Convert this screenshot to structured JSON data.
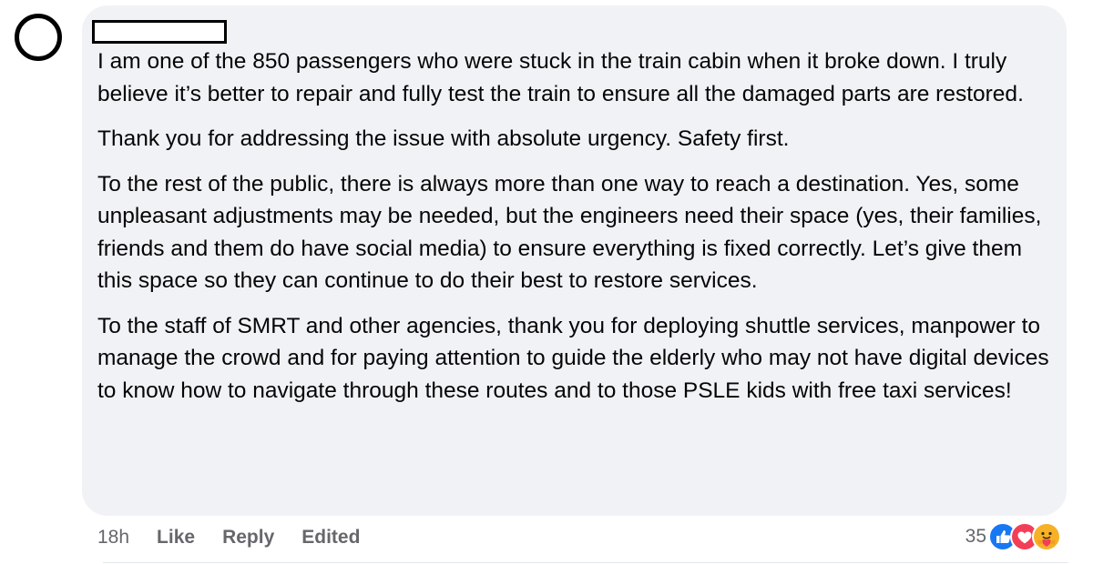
{
  "comment": {
    "paragraphs": [
      "I am one of the 850 passengers who were stuck in the train cabin when it broke down. I truly believe it’s better to repair and fully test the train to ensure all the damaged parts are restored.",
      "Thank you for addressing the issue with absolute urgency. Safety first.",
      "To the rest of the public, there is always more than one way to reach a destination. Yes, some unpleasant adjustments may be needed, but the engineers need their space (yes, their families, friends and them do have social media) to ensure everything is fixed correctly. Let’s give them this space so they can continue to do their best to restore services.",
      "To the staff of SMRT and other agencies, thank you for deploying shuttle services, manpower to manage the crowd and for paying attention to guide the elderly who may not have digital devices to know how to navigate through these routes and to those PSLE kids with free taxi services!"
    ]
  },
  "actions": {
    "time": "18h",
    "like_label": "Like",
    "reply_label": "Reply",
    "edited_label": "Edited"
  },
  "reactions": {
    "count": "35",
    "icons": [
      "like-icon",
      "love-icon",
      "care-icon"
    ]
  },
  "colors": {
    "bubble_bg": "#f0f2f5",
    "text": "#050505",
    "meta_text": "#65676b",
    "like_blue": "#1877f2",
    "love_red": "#f33e58",
    "care_yellow": "#f7b125"
  }
}
